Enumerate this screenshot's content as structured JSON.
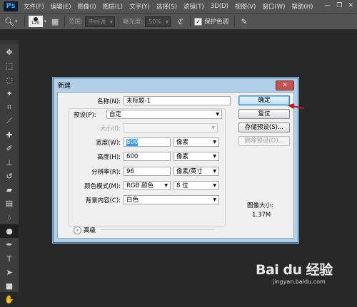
{
  "app": {
    "logo": "Ps"
  },
  "menubar": {
    "items": [
      "文件(F)",
      "编辑(E)",
      "图像(I)",
      "图层(L)",
      "文字(Y)",
      "选择(S)",
      "滤镜(T)",
      "3D(D)",
      "视图(V)",
      "窗口(W)",
      "帮助(H)"
    ]
  },
  "optionsbar": {
    "brush_size": "129",
    "range_label": "范围:",
    "range_value": "中间调",
    "exposure_label": "曝光度:",
    "exposure_value": "50%",
    "protect_tones_label": "保护色调",
    "protect_tones_checked": true
  },
  "dialog": {
    "title": "新建",
    "name_label": "名称(N):",
    "name_value": "未标题-1",
    "preset_label": "预设(P):",
    "preset_value": "自定",
    "size_label": "大小(I):",
    "size_value": "",
    "width_label": "宽度(W):",
    "width_value": "800",
    "width_unit": "像素",
    "height_label": "高度(H):",
    "height_value": "600",
    "height_unit": "像素",
    "resolution_label": "分辨率(R):",
    "resolution_value": "96",
    "resolution_unit": "像素/英寸",
    "color_mode_label": "颜色模式(M):",
    "color_mode_value": "RGB 颜色",
    "bit_depth_value": "8 位",
    "background_label": "背景内容(C):",
    "background_value": "白色",
    "advanced_label": "高级",
    "buttons": {
      "ok": "确定",
      "reset": "复位",
      "save_preset": "存储预设(S)...",
      "delete_preset": "删除预设(D)..."
    },
    "image_size_label": "图像大小:",
    "image_size_value": "1.37M"
  },
  "watermark": {
    "brand": "Bai du 经验",
    "url": "jingyan.baidu.com"
  },
  "colors": {
    "accent_arrow": "#c0181b",
    "dialog_frame": "#afd0e6",
    "ui_dark": "#282828"
  }
}
